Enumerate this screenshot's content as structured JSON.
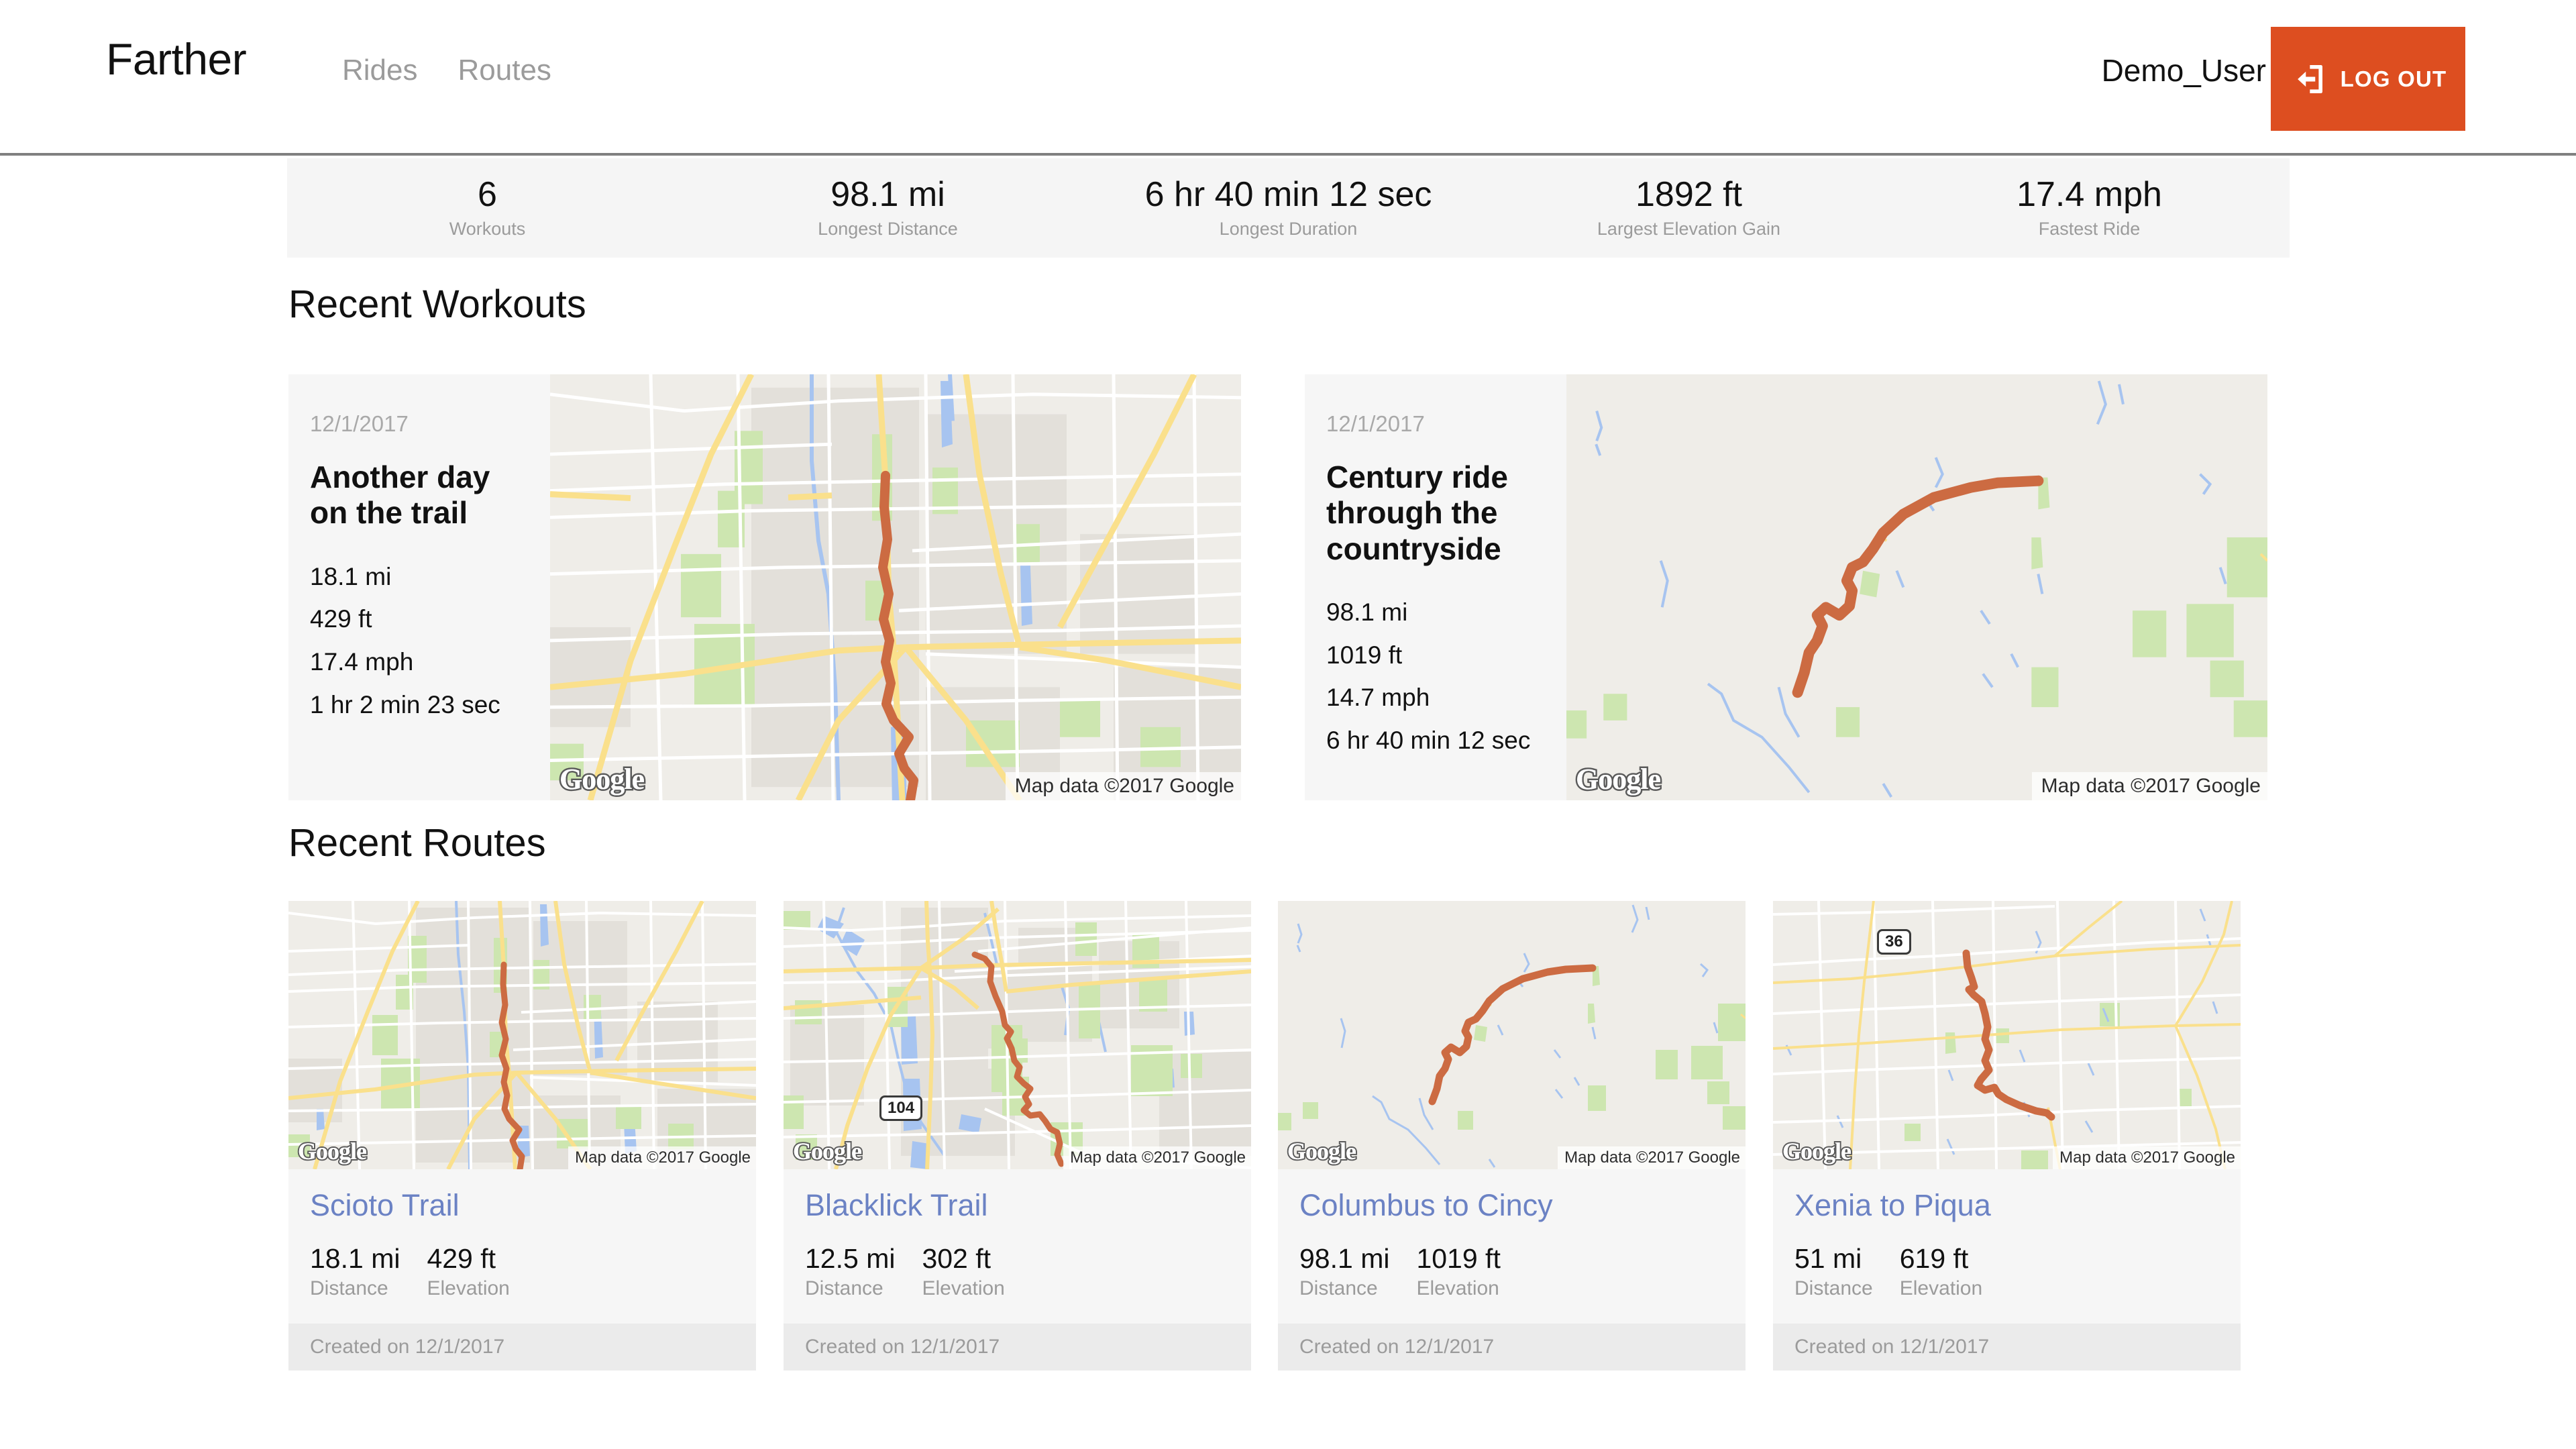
{
  "header": {
    "brand": "Farther",
    "nav": [
      {
        "label": "Rides",
        "name": "nav-rides"
      },
      {
        "label": "Routes",
        "name": "nav-routes"
      }
    ],
    "user_name": "Demo_User",
    "logout_label": "LOG OUT",
    "logout_icon": "logout-icon",
    "accent_color": "#DD4E20"
  },
  "stats": [
    {
      "value": "6",
      "label": "Workouts"
    },
    {
      "value": "98.1 mi",
      "label": "Longest Distance"
    },
    {
      "value": "6 hr 40 min 12 sec",
      "label": "Longest Duration"
    },
    {
      "value": "1892 ft",
      "label": "Largest Elevation Gain"
    },
    {
      "value": "17.4 mph",
      "label": "Fastest Ride"
    }
  ],
  "sections": {
    "workouts_title": "Recent Workouts",
    "routes_title": "Recent Routes"
  },
  "workouts": [
    {
      "date": "12/1/2017",
      "title": "Another day on the trail",
      "distance": "18.1 mi",
      "elevation": "429 ft",
      "speed": "17.4 mph",
      "duration": "1 hr 2 min 23 sec",
      "map": {
        "logo": "Google",
        "attribution": "Map data ©2017 Google"
      }
    },
    {
      "date": "12/1/2017",
      "title": "Century ride through the countryside",
      "distance": "98.1 mi",
      "elevation": "1019 ft",
      "speed": "14.7 mph",
      "duration": "6 hr 40 min 12 sec",
      "map": {
        "logo": "Google",
        "attribution": "Map data ©2017 Google"
      }
    }
  ],
  "routes": [
    {
      "title": "Scioto Trail",
      "distance_value": "18.1 mi",
      "distance_label": "Distance",
      "elevation_value": "429 ft",
      "elevation_label": "Elevation",
      "created": "Created on 12/1/2017",
      "map": {
        "logo": "Google",
        "attribution": "Map data ©2017 Google",
        "shield": ""
      }
    },
    {
      "title": "Blacklick Trail",
      "distance_value": "12.5 mi",
      "distance_label": "Distance",
      "elevation_value": "302 ft",
      "elevation_label": "Elevation",
      "created": "Created on 12/1/2017",
      "map": {
        "logo": "Google",
        "attribution": "Map data ©2017 Google",
        "shield": "104"
      }
    },
    {
      "title": "Columbus to Cincy",
      "distance_value": "98.1 mi",
      "distance_label": "Distance",
      "elevation_value": "1019 ft",
      "elevation_label": "Elevation",
      "created": "Created on 12/1/2017",
      "map": {
        "logo": "Google",
        "attribution": "Map data ©2017 Google",
        "shield": ""
      }
    },
    {
      "title": "Xenia to Piqua",
      "distance_value": "51 mi",
      "distance_label": "Distance",
      "elevation_value": "619 ft",
      "elevation_label": "Elevation",
      "created": "Created on 12/1/2017",
      "map": {
        "logo": "Google",
        "attribution": "Map data ©2017 Google",
        "shield": "36"
      }
    }
  ],
  "map_colors": {
    "land": "#EFEDE8",
    "urban": "#E3E0DA",
    "road": "#FFFFFF",
    "highway": "#FAE08C",
    "park": "#CDE6B0",
    "water": "#A7C4F0",
    "track": "#CC6B42"
  }
}
